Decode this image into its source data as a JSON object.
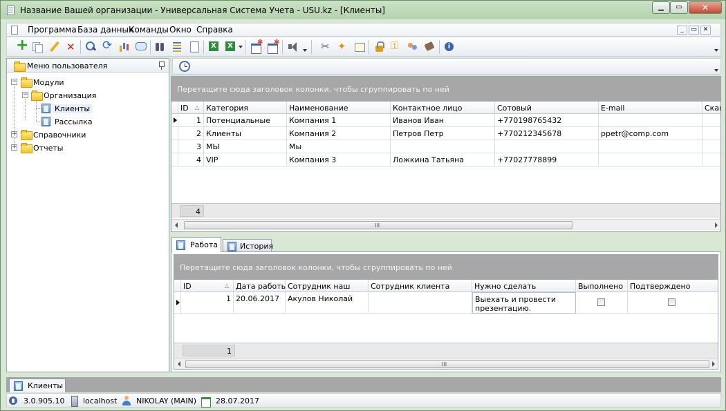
{
  "window": {
    "title": "Название Вашей организации - Универсальная Система Учета - USU.kz - [Клиенты]",
    "minimize_label": "▁",
    "maximize_label": "▭",
    "close_label": "✕"
  },
  "menu": {
    "items": [
      "Программа",
      "База данных",
      "Команды",
      "Окно",
      "Справка"
    ],
    "mdi_minimize": "_",
    "mdi_restore": "▭",
    "mdi_close": "✕"
  },
  "toolbar": {
    "icons": [
      "add-icon",
      "copy-icon",
      "edit-icon",
      "delete-icon",
      "search-icon",
      "refresh-icon",
      "chart-icon",
      "comment-icon",
      "binoculars-icon",
      "sort-icon",
      "document-icon",
      "export-excel-icon",
      "new-window-icon",
      "close-window-icon",
      "speaker-icon",
      "tools-icon",
      "wizard-icon",
      "form-icon",
      "lock-icon",
      "key-icon",
      "users-icon",
      "paint-icon",
      "info-icon"
    ]
  },
  "sidebar": {
    "title": "Меню пользователя",
    "tree": {
      "modules": "Модули",
      "organization": "Организация",
      "clients": "Клиенты",
      "mailing": "Рассылка",
      "directories": "Справочники",
      "reports": "Отчеты"
    }
  },
  "main_grid": {
    "group_hint": "Перетащите сюда заголовок колонки, чтобы сгруппировать по ней",
    "columns": [
      "ID",
      "Категория",
      "Наименование",
      "Контактное лицо",
      "Сотовый",
      "E-mail",
      "Скай"
    ],
    "rows": [
      {
        "id": "1",
        "category": "Потенциальные",
        "name": "Компания 1",
        "contact": "Иванов Иван",
        "mobile": "+770198765432",
        "email": ""
      },
      {
        "id": "2",
        "category": "Клиенты",
        "name": "Компания 2",
        "contact": "Петров Петр",
        "mobile": "+770212345678",
        "email": "ppetr@comp.com"
      },
      {
        "id": "3",
        "category": "МЫ",
        "name": "Мы",
        "contact": "",
        "mobile": "",
        "email": ""
      },
      {
        "id": "4",
        "category": "VIP",
        "name": "Компания 3",
        "contact": "Ложкина Татьяна",
        "mobile": "+77027778899",
        "email": ""
      }
    ],
    "footer_count": "4",
    "scroll_grip": "III"
  },
  "detail_tabs": {
    "tabs": [
      "Работа",
      "История"
    ],
    "active": "Работа"
  },
  "work_grid": {
    "group_hint": "Перетащите сюда заголовок колонки, чтобы сгруппировать по ней",
    "columns": [
      "ID",
      "Дата работы",
      "Сотрудник наш",
      "Сотрудник клиента",
      "Нужно сделать",
      "Выполнено",
      "Подтверждено"
    ],
    "rows": [
      {
        "id": "1",
        "date": "20.06.2017",
        "employee": "Акулов Николай",
        "client_employee": "",
        "todo_line1": "Выехать и провести",
        "todo_line2": "презентацию.",
        "done": false,
        "confirmed": false
      }
    ],
    "footer_count": "1",
    "scroll_grip": "III"
  },
  "doc_tabs": {
    "active": "Клиенты"
  },
  "status": {
    "version": "3.0.905.10",
    "server": "localhost",
    "user": "NIKOLAY (MAIN)",
    "date": "28.07.2017"
  }
}
